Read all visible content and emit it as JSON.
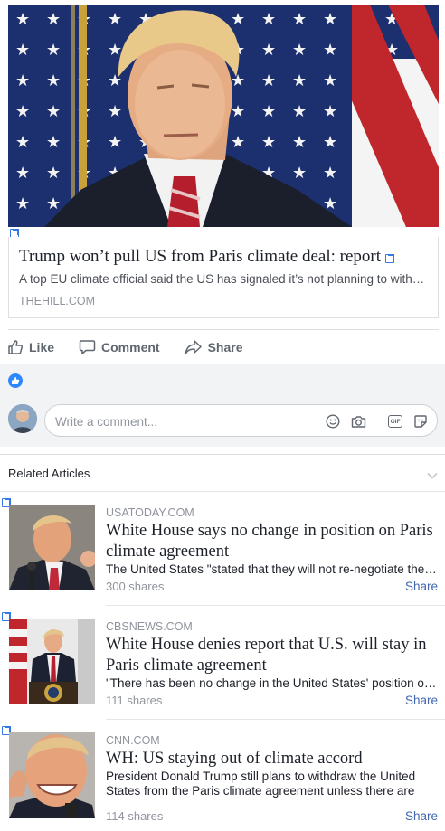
{
  "post": {
    "link": {
      "title": "Trump won’t pull US from Paris climate deal: report",
      "description": "A top EU climate official said the US has signaled it’s not planning to withdraw from the Paris climate agreement",
      "domain": "THEHILL.COM"
    },
    "actions": {
      "like": "Like",
      "comment": "Comment",
      "share": "Share"
    },
    "comment_box": {
      "placeholder": "Write a comment..."
    }
  },
  "related": {
    "header": "Related Articles",
    "items": [
      {
        "domain": "USATODAY.COM",
        "title": "White House says no change in position on Paris climate agreement",
        "description": "The United States \"stated that they will not re-negotiate the Paris accord\"",
        "shares": "300 shares",
        "share_label": "Share"
      },
      {
        "domain": "CBSNEWS.COM",
        "title": "White House denies report that U.S. will stay in Paris climate agreement",
        "description": "\"There has been no change in the United States' position on the Paris agreement\"",
        "shares": "111 shares",
        "share_label": "Share"
      },
      {
        "domain": "CNN.COM",
        "title": "WH: US staying out of climate accord",
        "description": "President Donald Trump still plans to withdraw the United States from the Paris climate agreement unless there are",
        "shares": "114 shares",
        "share_label": "Share"
      }
    ]
  },
  "icons": {
    "external_link": "external-link-icon",
    "like": "thumbs-up-icon",
    "comment": "speech-bubble-icon",
    "share": "share-arrow-icon",
    "reaction": "like-reaction-icon",
    "emoji": "smiley-icon",
    "camera": "camera-icon",
    "gif": "gif-icon",
    "sticker": "sticker-icon",
    "collapse": "chevron-down-icon"
  },
  "colors": {
    "link_blue": "#4267b2",
    "reaction_blue": "#2d88ff",
    "muted_text": "#90949c"
  }
}
